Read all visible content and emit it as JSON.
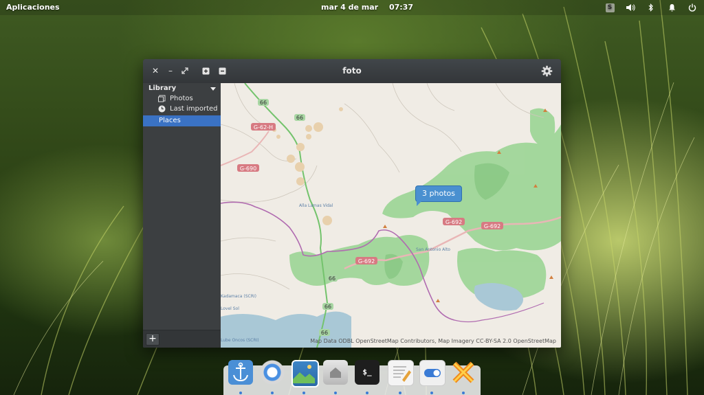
{
  "panel": {
    "apps_label": "Aplicaciones",
    "date": "mar 4 de mar",
    "time": "07:37",
    "tray": [
      "keyboard-indicator",
      "volume-icon",
      "bluetooth-icon",
      "notifications-icon",
      "power-icon"
    ],
    "keyboard_letter": "S"
  },
  "window": {
    "title": "foto",
    "controls": [
      "close-icon",
      "minimize-icon",
      "maximize-icon",
      "zoom-in-icon",
      "zoom-out-icon",
      "settings-gear-icon"
    ]
  },
  "sidebar": {
    "header": "Library",
    "items": [
      {
        "label": "Photos",
        "icon": "photos-icon"
      },
      {
        "label": "Last imported",
        "icon": "clock-icon"
      }
    ],
    "selected": "Places",
    "add_label": "+"
  },
  "map": {
    "marker_label": "3 photos",
    "attribution": "Map Data ODBL OpenStreetMap Contributors, Map Imagery CC-BY-SA 2.0 OpenStreetMap",
    "road_labels": [
      "66",
      "66",
      "G-62-H",
      "G-690",
      "G-692",
      "G-692",
      "G-692",
      "66",
      "66",
      "66"
    ],
    "place_labels": [
      "Alla Lamas Vidal",
      "San Antonio Alto",
      "Kadamaca (SCRI)",
      "Lovel Sol",
      "Lube Oncos (SCRI)"
    ]
  },
  "dock": {
    "apps": [
      "anchor-app-icon",
      "browser-icon",
      "photos-app-icon",
      "files-icon",
      "terminal-icon",
      "text-editor-icon",
      "settings-toggle-icon",
      "game-x-icon"
    ],
    "terminal_text": "$_"
  },
  "colors": {
    "accent": "#3a72c4",
    "marker": "#4a90d0",
    "water": "#a9c8d6",
    "forest": "#8fcf8a",
    "boundary": "#b06bb0"
  }
}
